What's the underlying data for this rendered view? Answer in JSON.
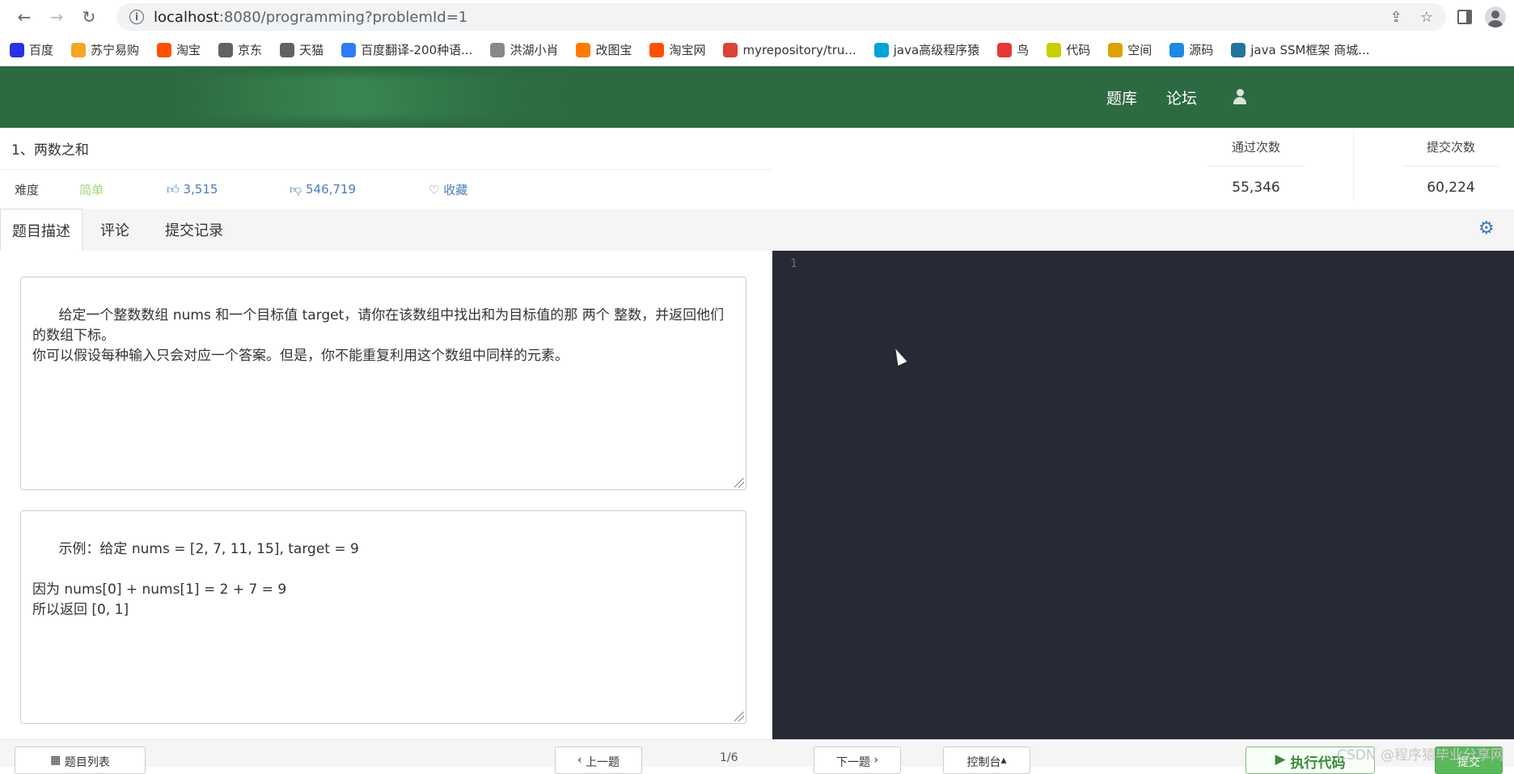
{
  "browser": {
    "url_host": "localhost",
    "url_rest": ":8080/programming?problemId=1",
    "bookmarks": [
      {
        "label": "百度",
        "color": "#2932e1"
      },
      {
        "label": "苏宁易购",
        "color": "#f5a623"
      },
      {
        "label": "淘宝",
        "color": "#ff5000"
      },
      {
        "label": "京东",
        "color": "#5f6368"
      },
      {
        "label": "天猫",
        "color": "#5f6368"
      },
      {
        "label": "百度翻译-200种语...",
        "color": "#2f7cf6"
      },
      {
        "label": "洪湖小肖",
        "color": "#888888"
      },
      {
        "label": "改图宝",
        "color": "#ff7a00"
      },
      {
        "label": "淘宝网",
        "color": "#ff5000"
      },
      {
        "label": "myrepository/tru...",
        "color": "#db4437"
      },
      {
        "label": "java高级程序猿",
        "color": "#00a1d6"
      },
      {
        "label": "鸟",
        "color": "#e53935"
      },
      {
        "label": "代码",
        "color": "#c8d000"
      },
      {
        "label": "空间",
        "color": "#e0a000"
      },
      {
        "label": "源码",
        "color": "#1e88e5"
      },
      {
        "label": "java SSM框架 商城...",
        "color": "#21759b"
      }
    ]
  },
  "header": {
    "nav": [
      "题库",
      "论坛"
    ]
  },
  "problem": {
    "title": "1、两数之和",
    "difficulty_label": "难度",
    "difficulty": "简单",
    "likes": "3,515",
    "dislikes": "546,719",
    "favorite": "收藏",
    "pass_label": "通过次数",
    "pass_count": "55,346",
    "submit_label": "提交次数",
    "submit_count": "60,224"
  },
  "tabs": [
    {
      "label": "题目描述",
      "active": true
    },
    {
      "label": "评论",
      "active": false
    },
    {
      "label": "提交记录",
      "active": false
    }
  ],
  "description": "给定一个整数数组 nums 和一个目标值 target，请你在该数组中找出和为目标值的那 两个 整数，并返回他们的数组下标。\n你可以假设每种输入只会对应一个答案。但是，你不能重复利用这个数组中同样的元素。",
  "example": "示例：给定 nums = [2, 7, 11, 15], target = 9\n\n因为 nums[0] + nums[1] = 2 + 7 = 9\n所以返回 [0, 1]",
  "editor": {
    "line_number": "1"
  },
  "bottom": {
    "list_btn": "题目列表",
    "prev_btn": "上一题",
    "pager": "1/6",
    "next_btn": "下一题",
    "console_btn": "控制台",
    "run_btn": "执行代码",
    "submit_btn": "提交",
    "watermark": "CSDN @程序猿毕业分享网"
  }
}
